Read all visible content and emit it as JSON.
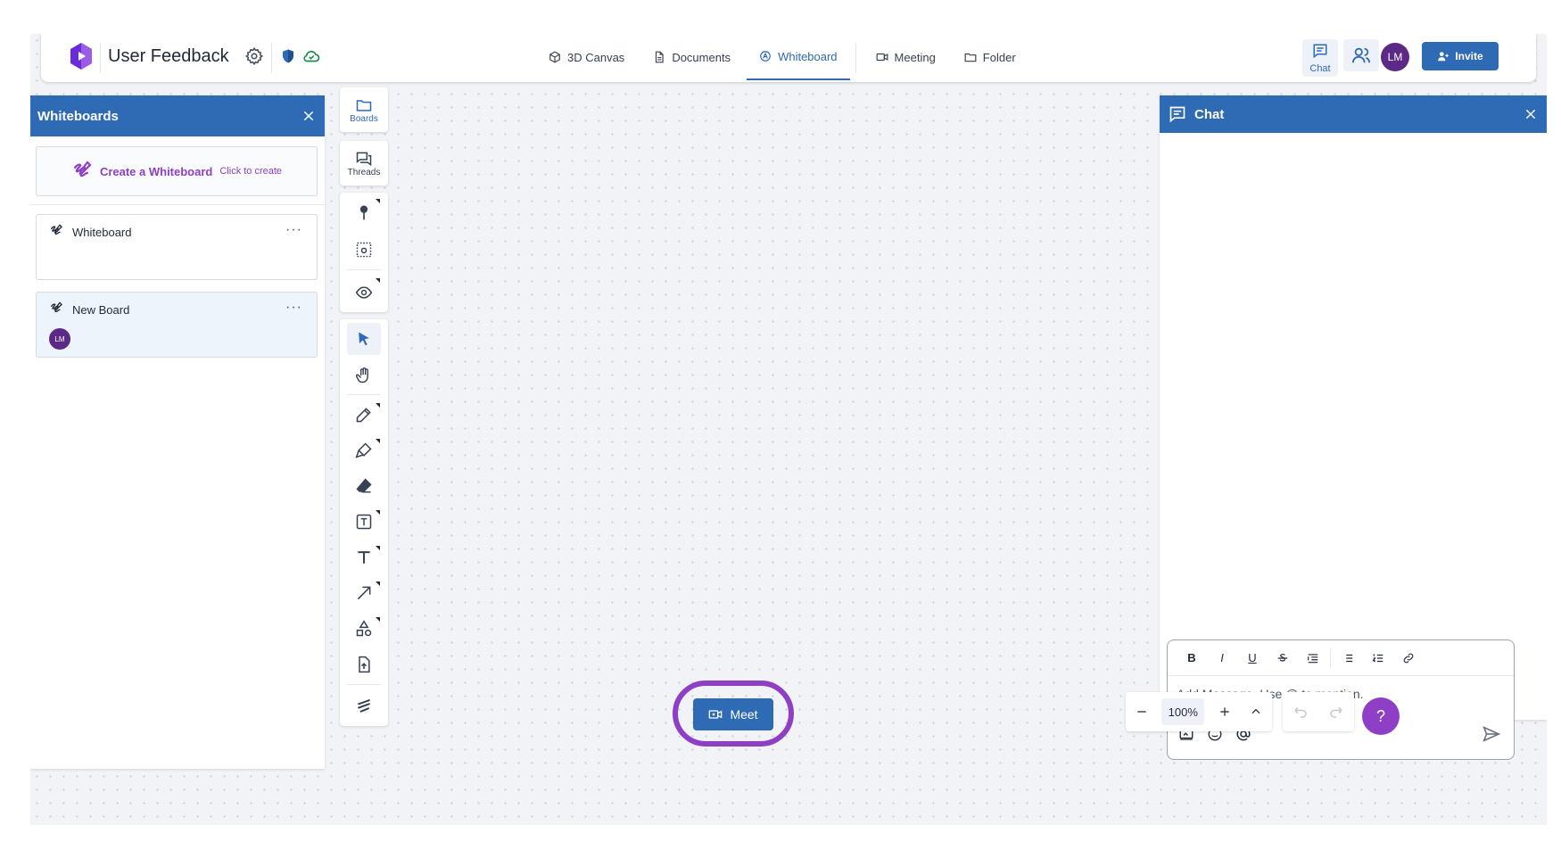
{
  "header": {
    "project_title": "User Feedback",
    "icons": [
      "gear-icon",
      "shield-icon",
      "cloud-check-icon"
    ],
    "nav_tabs": [
      {
        "label": "3D Canvas",
        "icon": "cube-icon"
      },
      {
        "label": "Documents",
        "icon": "document-icon"
      },
      {
        "label": "Whiteboard",
        "icon": "whiteboard-icon",
        "active": true
      },
      {
        "label": "Meeting",
        "icon": "video-icon"
      },
      {
        "label": "Folder",
        "icon": "folder-icon"
      }
    ],
    "chat_label": "Chat",
    "avatar_initials": "LM",
    "invite_label": "Invite"
  },
  "whiteboards_panel": {
    "title": "Whiteboards",
    "create": {
      "title": "Create a Whiteboard",
      "subtitle": "Click to create"
    },
    "boards": [
      {
        "name": "Whiteboard",
        "more": "···"
      },
      {
        "name": "New Board",
        "more": "···",
        "avatar": "LM",
        "selected": true
      }
    ]
  },
  "rail": {
    "boards_label": "Boards",
    "threads_label": "Threads",
    "tools": [
      "pin-icon",
      "area-capture-icon",
      "eye-icon",
      "select-icon",
      "hand-icon",
      "pencil-icon",
      "highlighter-icon",
      "eraser-icon",
      "text-box-icon",
      "text-icon",
      "arrow-icon",
      "shapes-icon",
      "upload-icon",
      "clear-icon"
    ]
  },
  "chat_panel": {
    "title": "Chat",
    "format_buttons": [
      "B",
      "I",
      "U"
    ],
    "input_placeholder": "Add Message. Use @ to mention."
  },
  "bottom": {
    "meet_label": "Meet",
    "zoom_value": "100%",
    "help_label": "?"
  },
  "colors": {
    "primary": "#2f6ab5",
    "accent": "#8e3fc5",
    "avatar": "#5b2a86"
  }
}
